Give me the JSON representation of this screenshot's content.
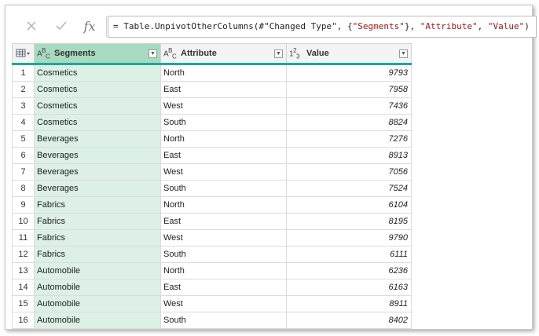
{
  "formula_bar": {
    "cancel_icon": "close-icon",
    "accept_icon": "check-icon",
    "fx_label": "fx",
    "formula_prefix": "= Table.UnpivotOtherColumns(#\"Changed Type\", {",
    "formula_str1": "\"Segments\"",
    "formula_mid": "}, ",
    "formula_str2": "\"Attribute\"",
    "formula_sep": ", ",
    "formula_str3": "\"Value\"",
    "formula_suffix": ")"
  },
  "columns": [
    {
      "type_icon": "ABC",
      "label": "Segments"
    },
    {
      "type_icon": "ABC",
      "label": "Attribute"
    },
    {
      "type_icon": "123",
      "label": "Value"
    }
  ],
  "rows": [
    {
      "n": "1",
      "segment": "Cosmetics",
      "attribute": "North",
      "value": "9793"
    },
    {
      "n": "2",
      "segment": "Cosmetics",
      "attribute": "East",
      "value": "7958"
    },
    {
      "n": "3",
      "segment": "Cosmetics",
      "attribute": "West",
      "value": "7436"
    },
    {
      "n": "4",
      "segment": "Cosmetics",
      "attribute": "South",
      "value": "8824"
    },
    {
      "n": "5",
      "segment": "Beverages",
      "attribute": "North",
      "value": "7276"
    },
    {
      "n": "6",
      "segment": "Beverages",
      "attribute": "East",
      "value": "8913"
    },
    {
      "n": "7",
      "segment": "Beverages",
      "attribute": "West",
      "value": "7056"
    },
    {
      "n": "8",
      "segment": "Beverages",
      "attribute": "South",
      "value": "7524"
    },
    {
      "n": "9",
      "segment": "Fabrics",
      "attribute": "North",
      "value": "6104"
    },
    {
      "n": "10",
      "segment": "Fabrics",
      "attribute": "East",
      "value": "8195"
    },
    {
      "n": "11",
      "segment": "Fabrics",
      "attribute": "West",
      "value": "9790"
    },
    {
      "n": "12",
      "segment": "Fabrics",
      "attribute": "South",
      "value": "6111"
    },
    {
      "n": "13",
      "segment": "Automobile",
      "attribute": "North",
      "value": "6236"
    },
    {
      "n": "14",
      "segment": "Automobile",
      "attribute": "East",
      "value": "6163"
    },
    {
      "n": "15",
      "segment": "Automobile",
      "attribute": "West",
      "value": "8911"
    },
    {
      "n": "16",
      "segment": "Automobile",
      "attribute": "South",
      "value": "8402"
    }
  ],
  "colors": {
    "selected_header": "#a7dac0",
    "selected_column": "#dcf0e5",
    "header_underline": "#1aa99b"
  }
}
